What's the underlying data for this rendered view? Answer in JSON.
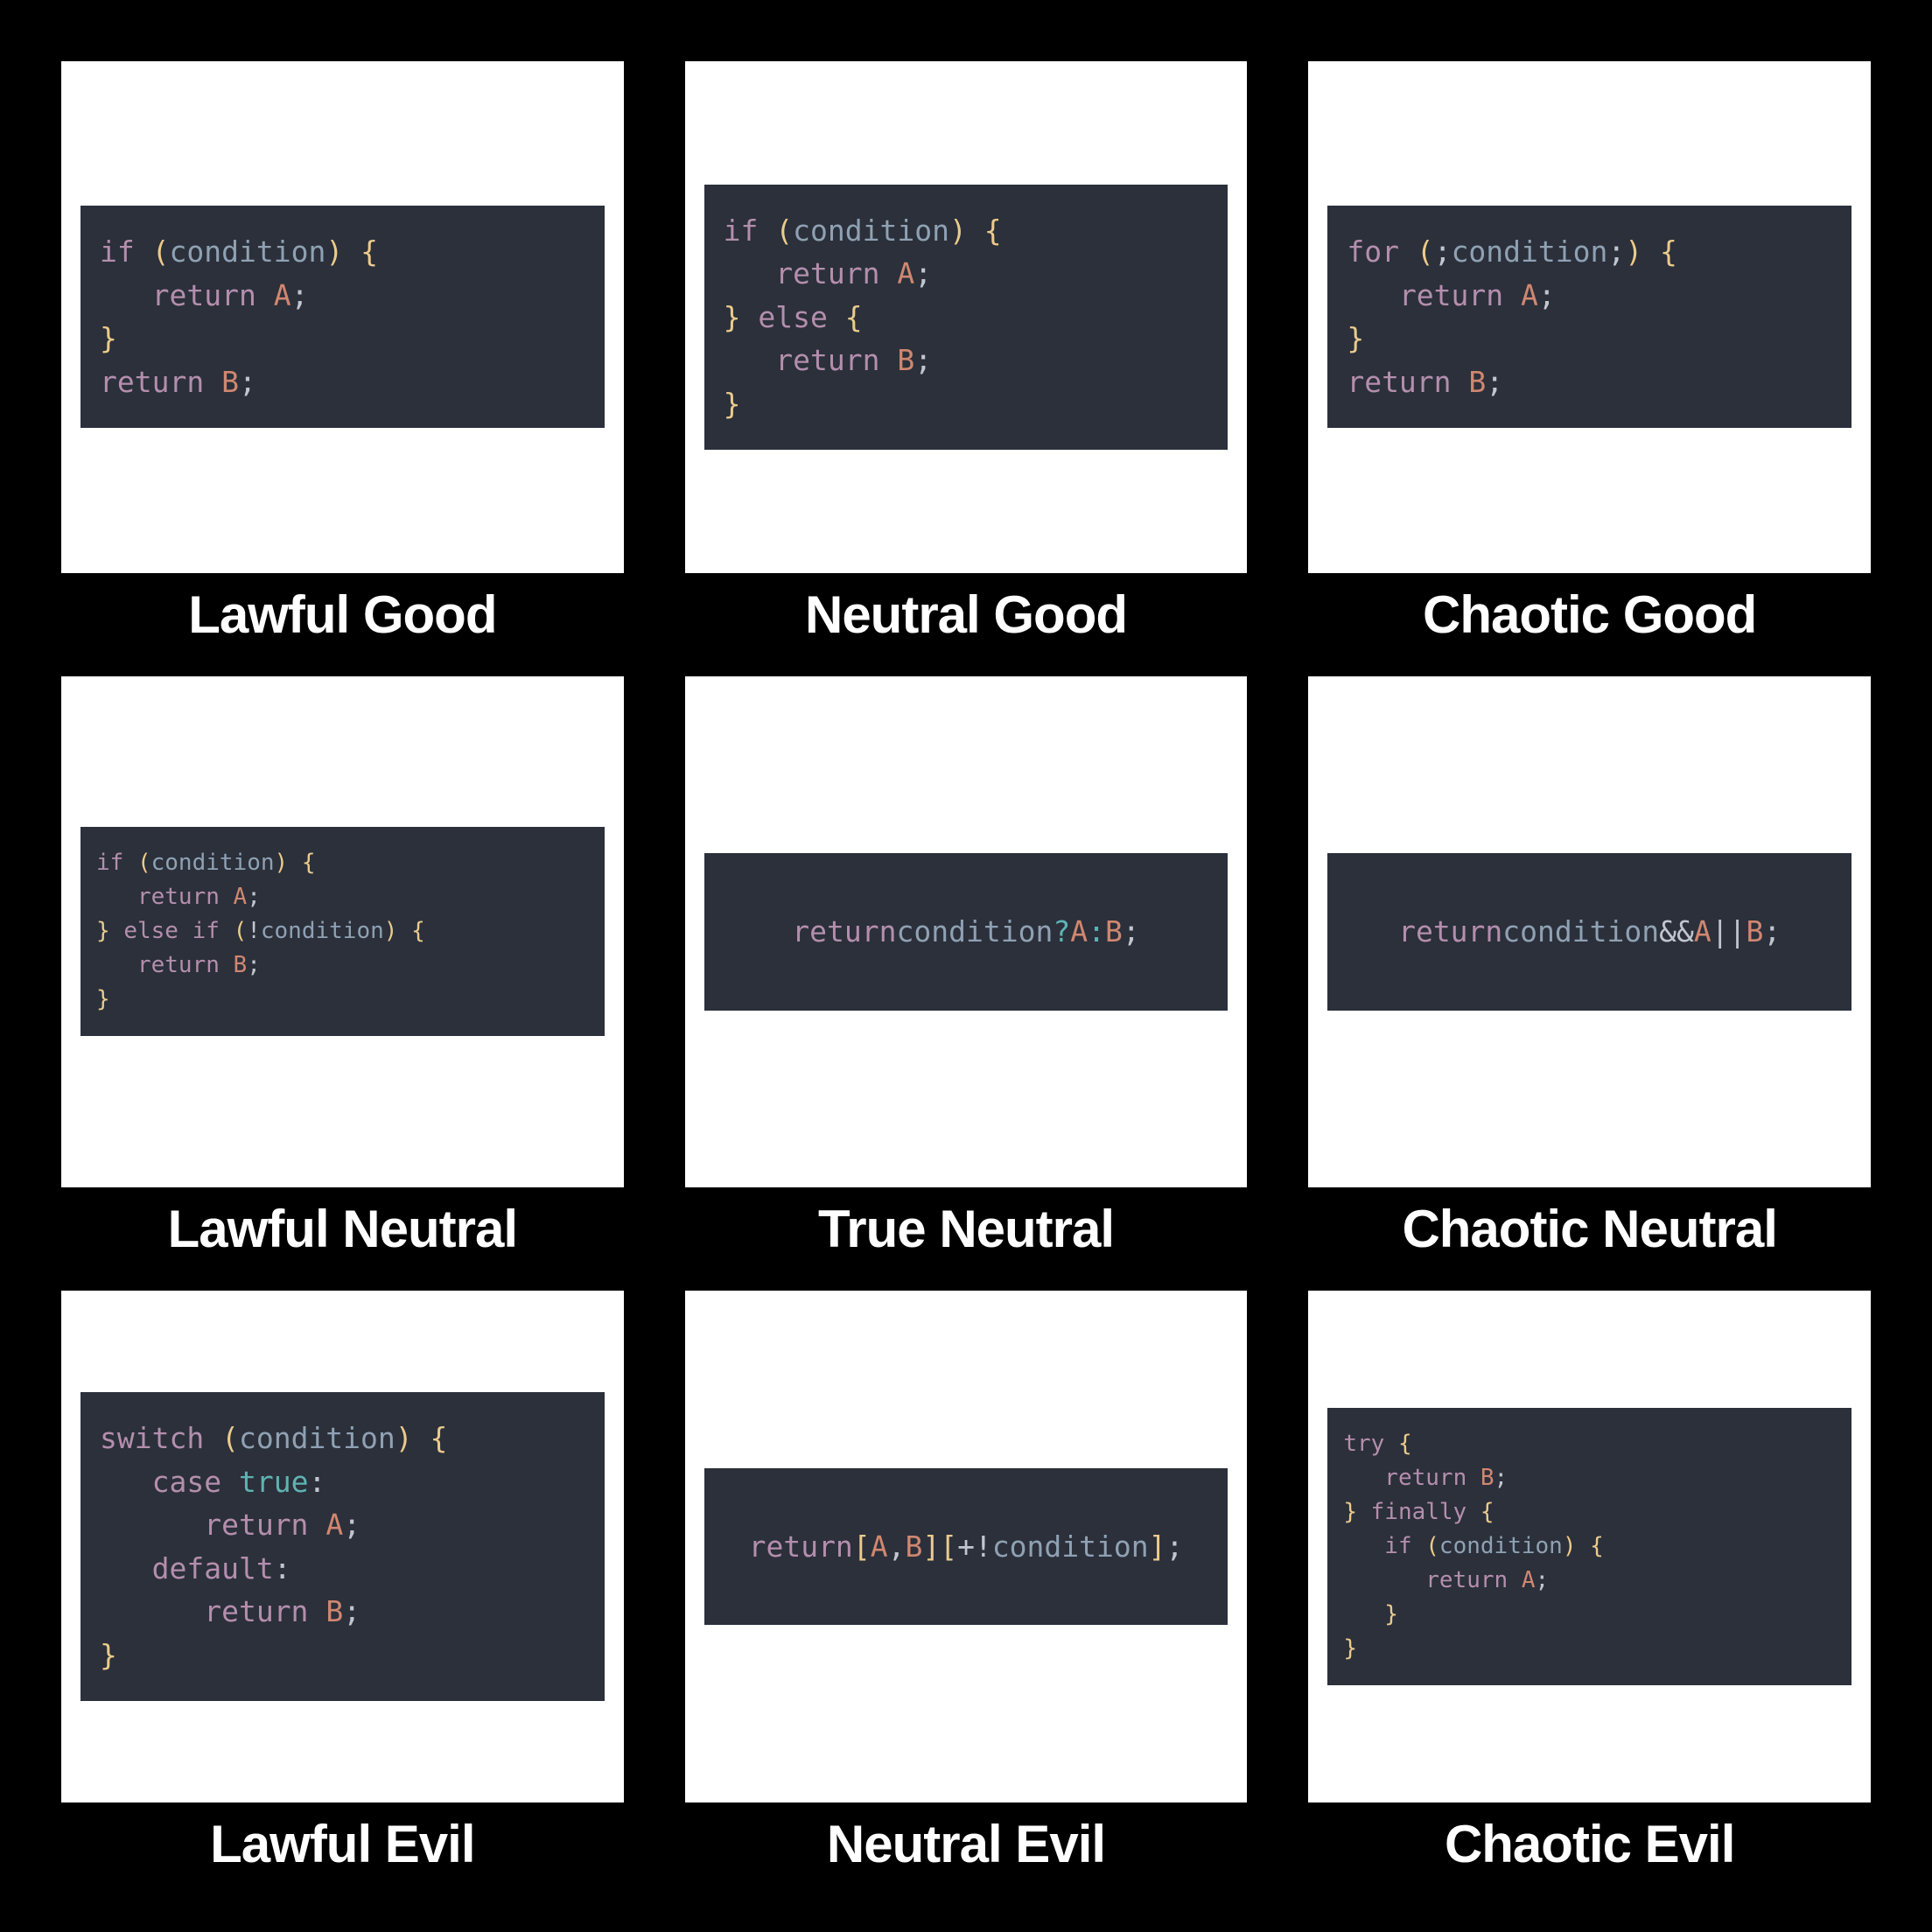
{
  "cells": [
    {
      "caption": "Lawful Good",
      "code_tokens": [
        [
          [
            "kw",
            "if"
          ],
          [
            "pn",
            " "
          ],
          [
            "br",
            "("
          ],
          [
            "id",
            "condition"
          ],
          [
            "br",
            ")"
          ],
          [
            "pn",
            " "
          ],
          [
            "br",
            "{"
          ]
        ],
        [
          [
            "pn",
            "   "
          ],
          [
            "kw",
            "return"
          ],
          [
            "pn",
            " "
          ],
          [
            "vr",
            "A"
          ],
          [
            "pn",
            ";"
          ]
        ],
        [
          [
            "br",
            "}"
          ]
        ],
        [
          [
            "kw",
            "return"
          ],
          [
            "pn",
            " "
          ],
          [
            "vr",
            "B"
          ],
          [
            "pn",
            ";"
          ]
        ]
      ],
      "code_class": ""
    },
    {
      "caption": "Neutral Good",
      "code_tokens": [
        [
          [
            "kw",
            "if"
          ],
          [
            "pn",
            " "
          ],
          [
            "br",
            "("
          ],
          [
            "id",
            "condition"
          ],
          [
            "br",
            ")"
          ],
          [
            "pn",
            " "
          ],
          [
            "br",
            "{"
          ]
        ],
        [
          [
            "pn",
            "   "
          ],
          [
            "kw",
            "return"
          ],
          [
            "pn",
            " "
          ],
          [
            "vr",
            "A"
          ],
          [
            "pn",
            ";"
          ]
        ],
        [
          [
            "br",
            "}"
          ],
          [
            "pn",
            " "
          ],
          [
            "kw",
            "else"
          ],
          [
            "pn",
            " "
          ],
          [
            "br",
            "{"
          ]
        ],
        [
          [
            "pn",
            "   "
          ],
          [
            "kw",
            "return"
          ],
          [
            "pn",
            " "
          ],
          [
            "vr",
            "B"
          ],
          [
            "pn",
            ";"
          ]
        ],
        [
          [
            "br",
            "}"
          ]
        ]
      ],
      "code_class": ""
    },
    {
      "caption": "Chaotic Good",
      "code_tokens": [
        [
          [
            "kw",
            "for"
          ],
          [
            "pn",
            " "
          ],
          [
            "br",
            "("
          ],
          [
            "pn",
            ";"
          ],
          [
            "id",
            "condition"
          ],
          [
            "pn",
            ";"
          ],
          [
            "br",
            ")"
          ],
          [
            "pn",
            " "
          ],
          [
            "br",
            "{"
          ]
        ],
        [
          [
            "pn",
            "   "
          ],
          [
            "kw",
            "return"
          ],
          [
            "pn",
            " "
          ],
          [
            "vr",
            "A"
          ],
          [
            "pn",
            ";"
          ]
        ],
        [
          [
            "br",
            "}"
          ]
        ],
        [
          [
            "kw",
            "return"
          ],
          [
            "pn",
            " "
          ],
          [
            "vr",
            "B"
          ],
          [
            "pn",
            ";"
          ]
        ]
      ],
      "code_class": ""
    },
    {
      "caption": "Lawful Neutral",
      "code_tokens": [
        [
          [
            "kw",
            "if"
          ],
          [
            "pn",
            " "
          ],
          [
            "br",
            "("
          ],
          [
            "id",
            "condition"
          ],
          [
            "br",
            ")"
          ],
          [
            "pn",
            " "
          ],
          [
            "br",
            "{"
          ]
        ],
        [
          [
            "pn",
            "   "
          ],
          [
            "kw",
            "return"
          ],
          [
            "pn",
            " "
          ],
          [
            "vr",
            "A"
          ],
          [
            "pn",
            ";"
          ]
        ],
        [
          [
            "br",
            "}"
          ],
          [
            "pn",
            " "
          ],
          [
            "kw",
            "else"
          ],
          [
            "pn",
            " "
          ],
          [
            "kw",
            "if"
          ],
          [
            "pn",
            " "
          ],
          [
            "br",
            "("
          ],
          [
            "pn",
            "!"
          ],
          [
            "id",
            "condition"
          ],
          [
            "br",
            ")"
          ],
          [
            "pn",
            " "
          ],
          [
            "br",
            "{"
          ]
        ],
        [
          [
            "pn",
            "   "
          ],
          [
            "kw",
            "return"
          ],
          [
            "pn",
            " "
          ],
          [
            "vr",
            "B"
          ],
          [
            "pn",
            ";"
          ]
        ],
        [
          [
            "br",
            "}"
          ]
        ]
      ],
      "code_class": "small"
    },
    {
      "caption": "True Neutral",
      "code_tokens": [
        [
          [
            "kw",
            "return"
          ],
          [
            "pn",
            " "
          ],
          [
            "id",
            "condition"
          ],
          [
            "pn",
            " "
          ],
          [
            "bl",
            "?"
          ],
          [
            "pn",
            " "
          ],
          [
            "vr",
            "A"
          ],
          [
            "pn",
            " "
          ],
          [
            "bl",
            ":"
          ],
          [
            "pn",
            " "
          ],
          [
            "vr",
            "B"
          ],
          [
            "pn",
            ";"
          ]
        ]
      ],
      "code_class": "oneline"
    },
    {
      "caption": "Chaotic Neutral",
      "code_tokens": [
        [
          [
            "kw",
            "return"
          ],
          [
            "pn",
            " "
          ],
          [
            "id",
            "condition"
          ],
          [
            "pn",
            " "
          ],
          [
            "pn",
            "&&"
          ],
          [
            "pn",
            " "
          ],
          [
            "vr",
            "A"
          ],
          [
            "pn",
            " "
          ],
          [
            "pn",
            "||"
          ],
          [
            "pn",
            " "
          ],
          [
            "vr",
            "B"
          ],
          [
            "pn",
            ";"
          ]
        ]
      ],
      "code_class": "oneline"
    },
    {
      "caption": "Lawful Evil",
      "code_tokens": [
        [
          [
            "kw",
            "switch"
          ],
          [
            "pn",
            " "
          ],
          [
            "br",
            "("
          ],
          [
            "id",
            "condition"
          ],
          [
            "br",
            ")"
          ],
          [
            "pn",
            " "
          ],
          [
            "br",
            "{"
          ]
        ],
        [
          [
            "pn",
            "   "
          ],
          [
            "kw",
            "case"
          ],
          [
            "pn",
            " "
          ],
          [
            "bl",
            "true"
          ],
          [
            "pn",
            ":"
          ]
        ],
        [
          [
            "pn",
            "      "
          ],
          [
            "kw",
            "return"
          ],
          [
            "pn",
            " "
          ],
          [
            "vr",
            "A"
          ],
          [
            "pn",
            ";"
          ]
        ],
        [
          [
            "pn",
            "   "
          ],
          [
            "kw",
            "default"
          ],
          [
            "pn",
            ":"
          ]
        ],
        [
          [
            "pn",
            "      "
          ],
          [
            "kw",
            "return"
          ],
          [
            "pn",
            " "
          ],
          [
            "vr",
            "B"
          ],
          [
            "pn",
            ";"
          ]
        ],
        [
          [
            "br",
            "}"
          ]
        ]
      ],
      "code_class": ""
    },
    {
      "caption": "Neutral Evil",
      "code_tokens": [
        [
          [
            "kw",
            "return"
          ],
          [
            "pn",
            " "
          ],
          [
            "br",
            "["
          ],
          [
            "vr",
            "A"
          ],
          [
            "pn",
            ", "
          ],
          [
            "vr",
            "B"
          ],
          [
            "br",
            "]"
          ],
          [
            "br",
            "["
          ],
          [
            "pn",
            "+!"
          ],
          [
            "id",
            "condition"
          ],
          [
            "br",
            "]"
          ],
          [
            "pn",
            ";"
          ]
        ]
      ],
      "code_class": "oneline"
    },
    {
      "caption": "Chaotic Evil",
      "code_tokens": [
        [
          [
            "kw",
            "try"
          ],
          [
            "pn",
            " "
          ],
          [
            "br",
            "{"
          ]
        ],
        [
          [
            "pn",
            "   "
          ],
          [
            "kw",
            "return"
          ],
          [
            "pn",
            " "
          ],
          [
            "vr",
            "B"
          ],
          [
            "pn",
            ";"
          ]
        ],
        [
          [
            "br",
            "}"
          ],
          [
            "pn",
            " "
          ],
          [
            "kw",
            "finally"
          ],
          [
            "pn",
            " "
          ],
          [
            "br",
            "{"
          ]
        ],
        [
          [
            "pn",
            "   "
          ],
          [
            "kw",
            "if"
          ],
          [
            "pn",
            " "
          ],
          [
            "br",
            "("
          ],
          [
            "id",
            "condition"
          ],
          [
            "br",
            ")"
          ],
          [
            "pn",
            " "
          ],
          [
            "br",
            "{"
          ]
        ],
        [
          [
            "pn",
            "      "
          ],
          [
            "kw",
            "return"
          ],
          [
            "pn",
            " "
          ],
          [
            "vr",
            "A"
          ],
          [
            "pn",
            ";"
          ]
        ],
        [
          [
            "pn",
            "   "
          ],
          [
            "br",
            "}"
          ]
        ],
        [
          [
            "br",
            "}"
          ]
        ]
      ],
      "code_class": "small"
    }
  ]
}
